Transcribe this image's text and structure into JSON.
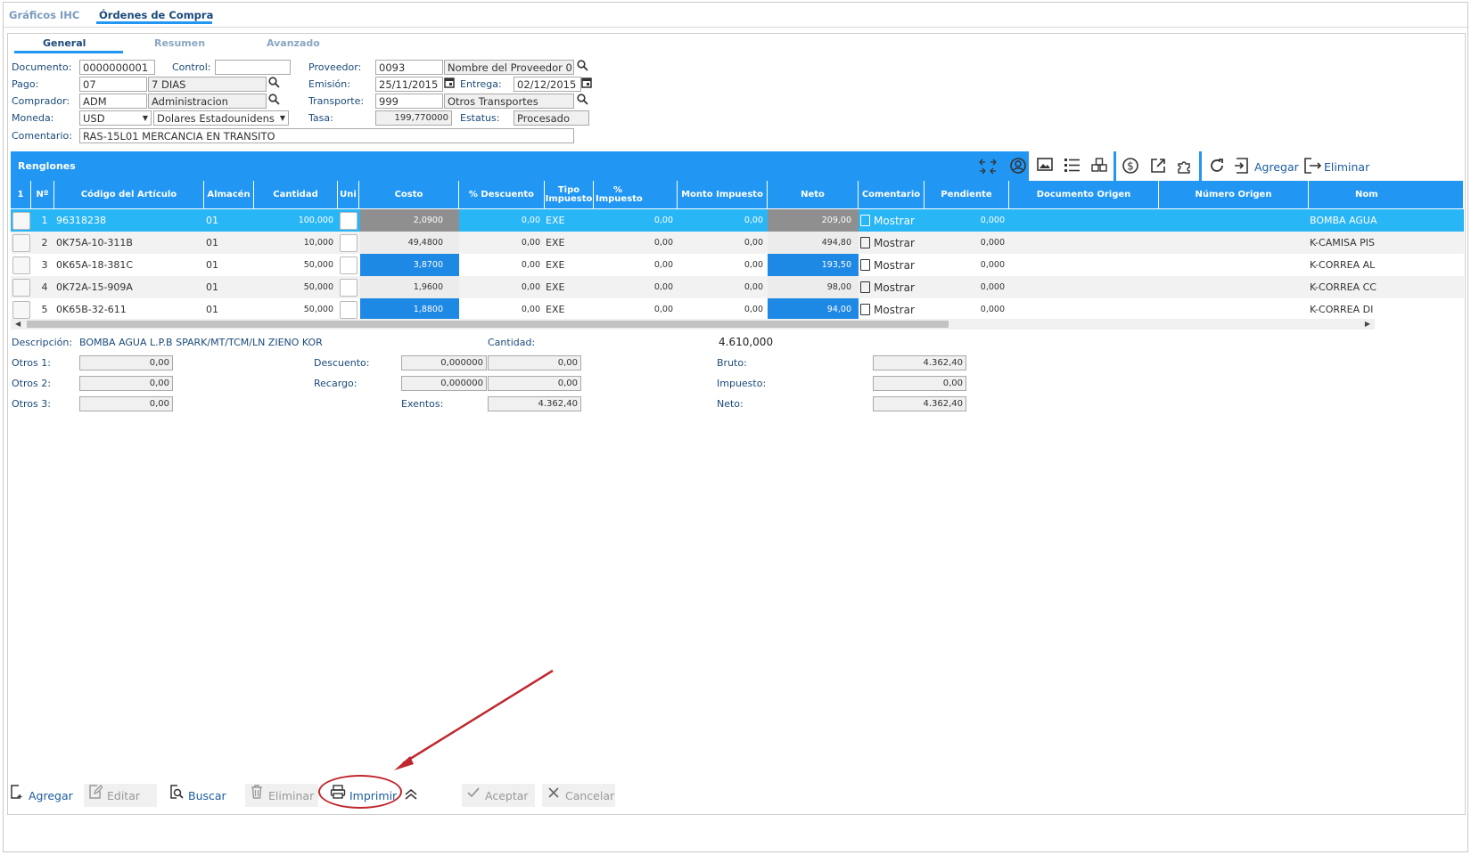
{
  "top_tabs": [
    {
      "label": "Gráficos IHC",
      "active": false
    },
    {
      "label": "Órdenes de Compra",
      "active": true
    }
  ],
  "sub_tabs": [
    {
      "label": "General",
      "active": true
    },
    {
      "label": "Resumen",
      "active": false
    },
    {
      "label": "Avanzado",
      "active": false
    }
  ],
  "form": {
    "documento_label": "Documento:",
    "documento": "0000000001",
    "control_label": "Control:",
    "control": "",
    "proveedor_label": "Proveedor:",
    "proveedor_code": "0093",
    "proveedor_name": "Nombre del Proveedor 0",
    "pago_label": "Pago:",
    "pago_code": "07",
    "pago_name": "7 DIAS",
    "emision_label": "Emisión:",
    "emision": "25/11/2015",
    "entrega_label": "Entrega:",
    "entrega": "02/12/2015",
    "comprador_label": "Comprador:",
    "comprador_code": "ADM",
    "comprador_name": "Administracion",
    "transporte_label": "Transporte:",
    "transporte_code": "999",
    "transporte_name": "Otros Transportes",
    "moneda_label": "Moneda:",
    "moneda_code": "USD",
    "moneda_name": "Dolares Estadounidens",
    "tasa_label": "Tasa:",
    "tasa": "199,770000",
    "estatus_label": "Estatus:",
    "estatus": "Procesado",
    "comentario_label": "Comentario:",
    "comentario": "RAS-15L01  MERCANCIA EN TRANSITO"
  },
  "renglones": {
    "title": "Renglones",
    "add_label": "Agregar",
    "remove_label": "Eliminar"
  },
  "grid": {
    "headers": {
      "sel": "1",
      "num": "Nº",
      "codigo": "Código del Artículo",
      "almacen": "Almacén",
      "cantidad": "Cantidad",
      "uni": "Uni",
      "costo": "Costo",
      "descuento": "% Descuento",
      "tipo_impuesto_1": "Tipo",
      "tipo_impuesto_2": "Impuesto",
      "pct_impuesto_1": "%",
      "pct_impuesto_2": "Impuesto",
      "monto_impuesto": "Monto Impuesto",
      "neto": "Neto",
      "comentario": "Comentario",
      "pendiente": "Pendiente",
      "doc_origen": "Documento Origen",
      "num_origen": "Número Origen",
      "nombre": "Nom"
    },
    "rows": [
      {
        "n": "1",
        "codigo": "96318238",
        "almacen": "01",
        "cantidad": "100,000",
        "costo": "2,0900",
        "descuento": "0,00",
        "tipo": "EXE",
        "pct": "0,00",
        "monto": "0,00",
        "neto": "209,00",
        "comentario": "Mostrar",
        "pendiente": "0,000",
        "nombre": "BOMBA AGUA"
      },
      {
        "n": "2",
        "codigo": "0K75A-10-311B",
        "almacen": "01",
        "cantidad": "10,000",
        "costo": "49,4800",
        "descuento": "0,00",
        "tipo": "EXE",
        "pct": "0,00",
        "monto": "0,00",
        "neto": "494,80",
        "comentario": "Mostrar",
        "pendiente": "0,000",
        "nombre": "K-CAMISA PIS"
      },
      {
        "n": "3",
        "codigo": "0K65A-18-381C",
        "almacen": "01",
        "cantidad": "50,000",
        "costo": "3,8700",
        "descuento": "0,00",
        "tipo": "EXE",
        "pct": "0,00",
        "monto": "0,00",
        "neto": "193,50",
        "comentario": "Mostrar",
        "pendiente": "0,000",
        "nombre": "K-CORREA AL"
      },
      {
        "n": "4",
        "codigo": "0K72A-15-909A",
        "almacen": "01",
        "cantidad": "50,000",
        "costo": "1,9600",
        "descuento": "0,00",
        "tipo": "EXE",
        "pct": "0,00",
        "monto": "0,00",
        "neto": "98,00",
        "comentario": "Mostrar",
        "pendiente": "0,000",
        "nombre": "K-CORREA CC"
      },
      {
        "n": "5",
        "codigo": "0K65B-32-611",
        "almacen": "01",
        "cantidad": "50,000",
        "costo": "1,8800",
        "descuento": "0,00",
        "tipo": "EXE",
        "pct": "0,00",
        "monto": "0,00",
        "neto": "94,00",
        "comentario": "Mostrar",
        "pendiente": "0,000",
        "nombre": "K-CORREA DI"
      }
    ]
  },
  "summary": {
    "descripcion_label": "Descripción:",
    "descripcion": "BOMBA AGUA L.P.B SPARK/MT/TCM/LN ZIENO KOR",
    "cantidad_label": "Cantidad:",
    "cantidad": "4.610,000",
    "otros1_label": "Otros 1:",
    "otros1": "0,00",
    "otros2_label": "Otros 2:",
    "otros2": "0,00",
    "otros3_label": "Otros 3:",
    "otros3": "0,00",
    "descuento_label": "Descuento:",
    "descuento_pct": "0,000000",
    "descuento_monto": "0,00",
    "recargo_label": "Recargo:",
    "recargo_pct": "0,000000",
    "recargo_monto": "0,00",
    "exentos_label": "Exentos:",
    "exentos": "4.362,40",
    "bruto_label": "Bruto:",
    "bruto": "4.362,40",
    "impuesto_label": "Impuesto:",
    "impuesto": "0,00",
    "neto_label": "Neto:",
    "neto": "4.362,40"
  },
  "bottom_toolbar": {
    "agregar": "Agregar",
    "editar": "Editar",
    "buscar": "Buscar",
    "eliminar": "Eliminar",
    "imprimir": "Imprimir",
    "aceptar": "Aceptar",
    "cancelar": "Cancelar"
  },
  "colors": {
    "accent": "#2196f3",
    "selected_row": "#29b6f6",
    "highlight_cell": "#1e88e5",
    "gray_cell": "#8f8f8f",
    "annotation_red": "#c0272d"
  }
}
